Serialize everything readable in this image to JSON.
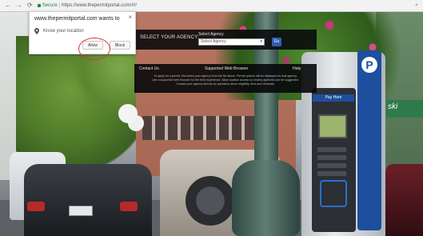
{
  "browser": {
    "back_icon": "back-arrow-icon",
    "forward_icon": "forward-arrow-icon",
    "reload_icon": "reload-icon",
    "secure_label": "Secure",
    "url_separator": "|",
    "url": "https://www.thepermitportal.com/#!/",
    "zoom_icon": "magnifier-icon"
  },
  "permission_popup": {
    "title": "www.thepermitportal.com wants to",
    "permission_text": "Know your location",
    "allow_label": "Allow",
    "block_label": "Block",
    "close_glyph": "×",
    "highlight_color": "#d23a3a"
  },
  "site_bar": {
    "select_agency_label": "SELECT YOUR AGENCY:",
    "select_field_label": "Select Agency",
    "select_value": "Select Agency",
    "go_label": "Go"
  },
  "info_bar": {
    "col_left": "Contact Us",
    "col_center": "Supported Web Browser",
    "col_right": "Help",
    "body_line1": "To apply for a permit, first select your agency from the list above. Permit options will be displayed for that agency.",
    "body_line2": "Use a supported web browser for the best experience. Allow location access so nearby agencies can be suggested.",
    "body_line3": "Contact your agency directly for questions about eligibility, fees and renewals."
  },
  "scene": {
    "meter_sign_letter": "P",
    "meter_label": "Pay Here",
    "awning_text": "ski"
  },
  "colors": {
    "secure_green": "#1a8a3a",
    "meter_blue": "#1d4f9e",
    "go_button_blue": "#2f5fb0"
  }
}
